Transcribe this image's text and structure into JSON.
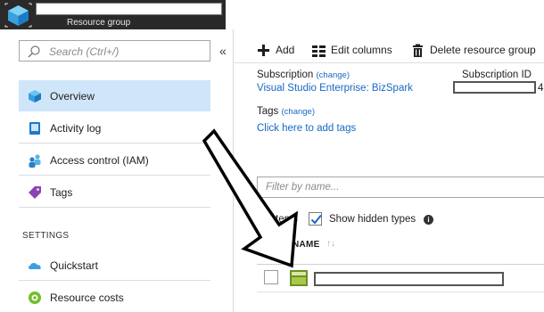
{
  "header": {
    "subtitle": "Resource group",
    "icon": "resource-group-cube-icon"
  },
  "left": {
    "search_placeholder": "Search (Ctrl+/)",
    "collapse_glyph": "«",
    "nav": [
      {
        "label": "Overview",
        "icon": "overview-icon",
        "active": true
      },
      {
        "label": "Activity log",
        "icon": "activity-log-icon"
      },
      {
        "label": "Access control (IAM)",
        "icon": "iam-icon"
      },
      {
        "label": "Tags",
        "icon": "tag-icon"
      }
    ],
    "section_settings": "SETTINGS",
    "settings": [
      {
        "label": "Quickstart",
        "icon": "quickstart-cloud-icon"
      },
      {
        "label": "Resource costs",
        "icon": "resource-costs-icon"
      }
    ]
  },
  "toolbar": {
    "add": "Add",
    "edit_columns": "Edit columns",
    "delete": "Delete resource group"
  },
  "essentials": {
    "subscription_label": "Subscription",
    "subscription_change": "(change)",
    "subscription_value": "Visual Studio Enterprise: BizSpark",
    "subscription_id_label": "Subscription ID",
    "subscription_id_suffix": "4",
    "tags_label": "Tags",
    "tags_change": "(change)",
    "tags_link": "Click here to add tags"
  },
  "list": {
    "filter_placeholder": "Filter by name...",
    "items_label": "tems",
    "show_hidden_types": "Show hidden types",
    "show_hidden_checked": true,
    "info_glyph": "i",
    "column_name": "NAME",
    "sort_glyph": "↑↓"
  },
  "colors": {
    "topbar": "#2a2a2a",
    "accent_link": "#1769c4",
    "active_nav": "#cfe6fa"
  }
}
